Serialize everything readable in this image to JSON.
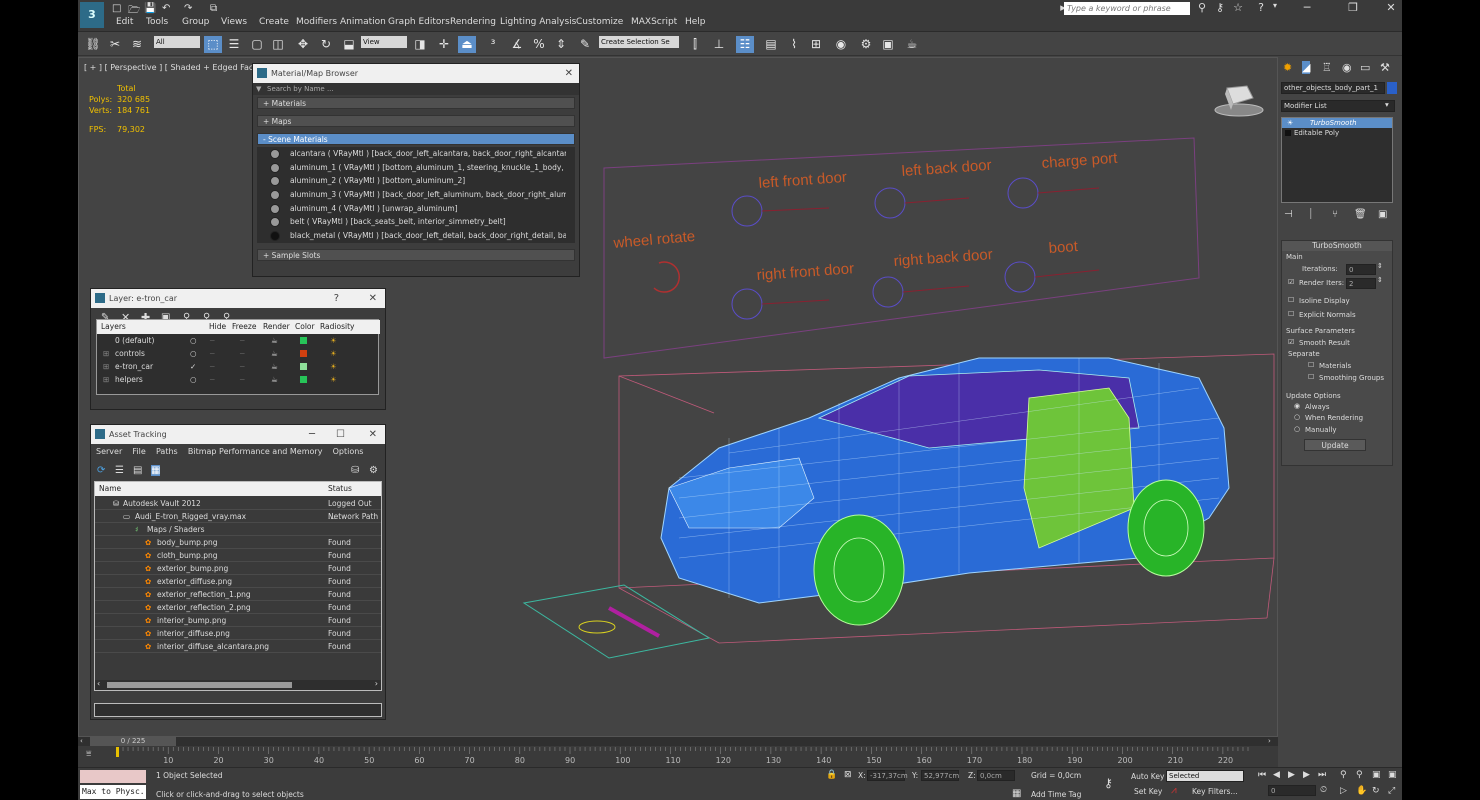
{
  "titlebar": {
    "quick_access": [
      "□",
      "🗁",
      "💾",
      "↶",
      "↷",
      "⧉"
    ],
    "menus": [
      "Edit",
      "Tools",
      "Group",
      "Views",
      "Create",
      "Modifiers",
      "Animation",
      "Graph Editors",
      "Rendering",
      "Lighting Analysis",
      "Customize",
      "MAXScript",
      "Help"
    ],
    "search_placeholder": "Type a keyword or phrase",
    "logo": "3"
  },
  "toolbar": {
    "filter": "All",
    "ref_coord": "View",
    "selection_set": "Create Selection Se"
  },
  "viewport": {
    "label": "[ + ] [ Perspective ] [ Shaded + Edged Faces ]",
    "stats": {
      "total_label": "Total",
      "polys_label": "Polys:",
      "polys": "320 685",
      "verts_label": "Verts:",
      "verts": "184 761",
      "fps_label": "FPS:",
      "fps": "79,302"
    },
    "scene_labels": {
      "wheel_rotate": "wheel rotate",
      "left_front_door": "left front door",
      "left_back_door": "left back door",
      "charge_port": "charge port",
      "right_front_door": "right front door",
      "right_back_door": "right back door",
      "boot": "boot"
    }
  },
  "material_browser": {
    "title": "Material/Map Browser",
    "search": "Search by Name ...",
    "sections": {
      "materials": "+ Materials",
      "maps": "+ Maps",
      "scene": "- Scene Materials",
      "sample": "+ Sample Slots"
    },
    "rows": [
      "alcantara  ( VRayMtl ) [back_door_left_alcantara, back_door_right_alcantara, fro...",
      "aluminum_1  ( VRayMtl ) [bottom_aluminum_1, steering_knuckle_1_body, steeri...",
      "aluminum_2  ( VRayMtl ) [bottom_aluminum_2]",
      "aluminum_3  ( VRayMtl ) [back_door_left_aluminum, back_door_right_aluminu...",
      "aluminum_4  ( VRayMtl ) [unwrap_aluminum]",
      "belt  ( VRayMtl ) [back_seats_belt, interior_simmetry_belt]",
      "black_metal  ( VRayMtl ) [back_door_left_detail, back_door_right_detail, back_s..."
    ]
  },
  "layer_window": {
    "title": "Layer: e-tron_car",
    "headers": {
      "layers": "Layers",
      "hide": "Hide",
      "freeze": "Freeze",
      "render": "Render",
      "color": "Color",
      "radiosity": "Radiosity"
    },
    "rows": [
      {
        "name": "0 (default)",
        "color": "#27c458"
      },
      {
        "name": "controls",
        "color": "#d04010"
      },
      {
        "name": "e-tron_car",
        "color": "#8fe09a"
      },
      {
        "name": "helpers",
        "color": "#27c458"
      }
    ]
  },
  "asset_tracking": {
    "title": "Asset Tracking",
    "menus": [
      "Server",
      "File",
      "Paths",
      "Bitmap Performance and Memory",
      "Options"
    ],
    "headers": {
      "name": "Name",
      "status": "Status"
    },
    "rows": [
      {
        "name": "Autodesk Vault 2012",
        "status": "Logged Out ..."
      },
      {
        "name": "Audi_E-tron_Rigged_vray.max",
        "status": "Network Path"
      },
      {
        "name": "Maps / Shaders",
        "status": ""
      },
      {
        "name": "body_bump.png",
        "status": "Found"
      },
      {
        "name": "cloth_bump.png",
        "status": "Found"
      },
      {
        "name": "exterior_bump.png",
        "status": "Found"
      },
      {
        "name": "exterior_diffuse.png",
        "status": "Found"
      },
      {
        "name": "exterior_reflection_1.png",
        "status": "Found"
      },
      {
        "name": "exterior_reflection_2.png",
        "status": "Found"
      },
      {
        "name": "interior_bump.png",
        "status": "Found"
      },
      {
        "name": "interior_diffuse.png",
        "status": "Found"
      },
      {
        "name": "interior_diffuse_alcantara.png",
        "status": "Found"
      }
    ]
  },
  "right_panel": {
    "object_name": "other_objects_body_part_1",
    "modifier_list": "Modifier List",
    "stack": [
      "TurboSmooth",
      "Editable Poly"
    ],
    "turbosmooth": {
      "title": "TurboSmooth",
      "main": "Main",
      "iterations_label": "Iterations:",
      "iterations": "0",
      "render_iters_label": "Render Iters:",
      "render_iters": "2",
      "isoline": "Isoline Display",
      "explicit": "Explicit Normals",
      "surface": "Surface Parameters",
      "smooth_result": "Smooth Result",
      "separate": "Separate",
      "materials": "Materials",
      "smoothing_groups": "Smoothing Groups",
      "update_options": "Update Options",
      "always": "Always",
      "when_rendering": "When Rendering",
      "manually": "Manually",
      "update": "Update"
    }
  },
  "timeline": {
    "frame": "0 / 225",
    "ticks": [
      "10",
      "20",
      "30",
      "40",
      "50",
      "60",
      "70",
      "80",
      "90",
      "100",
      "110",
      "120",
      "130",
      "140",
      "150",
      "160",
      "170",
      "180",
      "190",
      "200",
      "210",
      "220"
    ]
  },
  "status": {
    "script": "Max to Physc.",
    "selected": "1 Object Selected",
    "hint": "Click or click-and-drag to select objects",
    "x_label": "X:",
    "x": "-317,37cm",
    "y_label": "Y:",
    "y": "52,977cm",
    "z_label": "Z:",
    "z": "0,0cm",
    "grid": "Grid = 0,0cm",
    "add_time_tag": "Add Time Tag",
    "auto_key": "Auto Key",
    "selected_dd": "Selected",
    "set_key": "Set Key",
    "key_filters": "Key Filters...",
    "frame": "0"
  }
}
